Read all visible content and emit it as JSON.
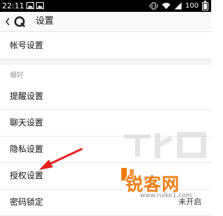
{
  "status_bar": {
    "time": "22:11",
    "battery": "100",
    "battery_level": 1.0
  },
  "header": {
    "title": "设置"
  },
  "settings": {
    "account": "帐号设置",
    "section_preferences": "偏好",
    "items": [
      {
        "label": "提醒设置"
      },
      {
        "label": "聊天设置"
      },
      {
        "label": "隐私设置"
      },
      {
        "label": "授权设置"
      },
      {
        "label": "密码锁定",
        "value": "未开启"
      }
    ]
  },
  "watermark": {
    "brand": "锐客网",
    "url": "www.ruike1.com"
  },
  "colors": {
    "watermark_orange": "#ef7e12",
    "arrow_red": "#e8201e",
    "status_bar": "#000000"
  }
}
